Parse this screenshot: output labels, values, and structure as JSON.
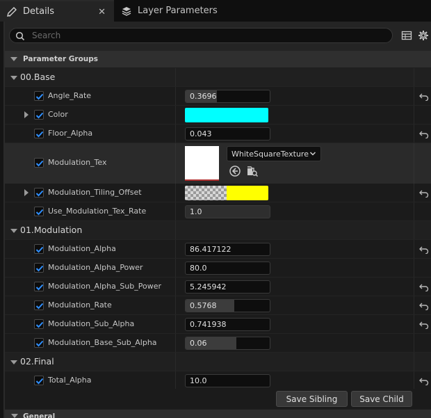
{
  "tabs": {
    "details": "Details",
    "details_close": "✕",
    "layer_params": "Layer Parameters"
  },
  "search": {
    "placeholder": "Search"
  },
  "groups": {
    "parameter_groups": "Parameter Groups",
    "general": "General"
  },
  "categories": {
    "base": "00.Base",
    "modulation": "01.Modulation",
    "final": "02.Final"
  },
  "params": {
    "angle_rate": {
      "name": "Angle_Rate",
      "value": "0.3696",
      "fill": 0.37
    },
    "color": {
      "name": "Color",
      "color": "#00FFFF"
    },
    "floor_alpha": {
      "name": "Floor_Alpha",
      "value": "0.043"
    },
    "modulation_tex": {
      "name": "Modulation_Tex",
      "texture": "WhiteSquareTexture"
    },
    "modulation_tiling_offset": {
      "name": "Modulation_Tiling_Offset",
      "color": "#FFFF00"
    },
    "use_modulation_tex_rate": {
      "name": "Use_Modulation_Tex_Rate",
      "value": "1.0"
    },
    "modulation_alpha": {
      "name": "Modulation_Alpha",
      "value": "86.417122"
    },
    "modulation_alpha_power": {
      "name": "Modulation_Alpha_Power",
      "value": "80.0"
    },
    "modulation_alpha_sub_power": {
      "name": "Modulation_Alpha_Sub_Power",
      "value": "5.245942"
    },
    "modulation_rate": {
      "name": "Modulation_Rate",
      "value": "0.5768",
      "fill": 0.58
    },
    "modulation_sub_alpha": {
      "name": "Modulation_Sub_Alpha",
      "value": "0.741938"
    },
    "modulation_base_sub_alpha": {
      "name": "Modulation_Base_Sub_Alpha",
      "value": "0.06",
      "fill": 0.6
    },
    "total_alpha": {
      "name": "Total_Alpha",
      "value": "10.0"
    }
  },
  "buttons": {
    "save_sibling": "Save Sibling",
    "save_child": "Save Child"
  },
  "colors": {
    "accent_check": "#2f8fff",
    "background": "#1b1b1b"
  }
}
